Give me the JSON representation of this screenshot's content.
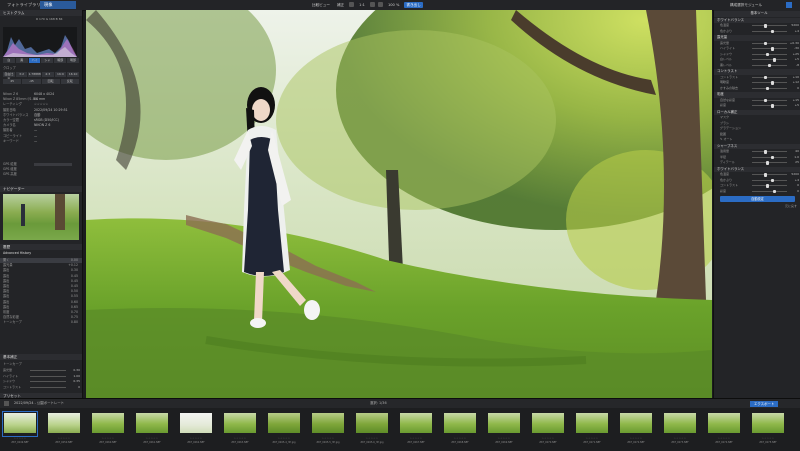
{
  "topbar": {
    "tabs": [
      {
        "label": "フォトライブラリ",
        "active": false
      },
      {
        "label": "現像",
        "active": true
      }
    ],
    "right_buttons": [
      "比較ビュー",
      "補正",
      "1:1",
      "100 %"
    ],
    "export_button": "書き出し",
    "right_label": "構成選択モジュール"
  },
  "left": {
    "histogram_title": "ヒストグラム",
    "histogram_readout": "R 170 G 168 B 84",
    "tool_row": [
      "白",
      "黒",
      "ハイ",
      "シャ",
      "暗部",
      "明部"
    ],
    "crop_title": "クロップ",
    "ratio_buttons": [
      "自由比率",
      "3:2",
      "1.78888",
      "4:3",
      "16:9",
      "16:10"
    ],
    "rotate_buttons": [
      "45",
      "-45",
      "回転",
      "反転"
    ],
    "meta": [
      {
        "k": "Nikon Z 6",
        "v": "6048 x 4024"
      },
      {
        "k": "Nikon Z 85mm f/1.8 S",
        "v": "84 mm"
      },
      {
        "k": "レーティング",
        "v": "☆☆☆☆☆"
      },
      {
        "k": "撮影日時",
        "v": "2022/09/24 10:29:51"
      },
      {
        "k": "ホワイトバランス",
        "v": "自動"
      },
      {
        "k": "カラー空間",
        "v": "sRGB (D50/ICC)"
      },
      {
        "k": "カメラ名",
        "v": "NIKON Z 6"
      },
      {
        "k": "撮影者",
        "v": "—"
      },
      {
        "k": "コピーライト",
        "v": "—"
      },
      {
        "k": "キーワード",
        "v": "—"
      }
    ],
    "gps_rows": [
      "GPS 緯度",
      "GPS 経度",
      "GPS 高度"
    ],
    "navigator_title": "ナビゲーター",
    "history_title": "履歴",
    "history_group": "Advanced History",
    "history_items": [
      {
        "label": "開く",
        "value": "0.00"
      },
      {
        "label": "露光量",
        "value": "+0.12"
      },
      {
        "label": "露出",
        "value": "0.30"
      },
      {
        "label": "露出",
        "value": "0.45"
      },
      {
        "label": "露出",
        "value": "0.45"
      },
      {
        "label": "露出",
        "value": "0.45"
      },
      {
        "label": "露出",
        "value": "0.50"
      },
      {
        "label": "露出",
        "value": "0.55"
      },
      {
        "label": "露出",
        "value": "0.60"
      },
      {
        "label": "露出",
        "value": "0.65"
      },
      {
        "label": "彩度",
        "value": "0.70"
      },
      {
        "label": "自然な彩度",
        "value": "0.75"
      },
      {
        "label": "トーンカーブ",
        "value": "0.80"
      }
    ],
    "tone_title": "基本補正",
    "tone_group": "トーンカーブ",
    "tone_rows": [
      {
        "label": "露光量",
        "value": "0.30"
      },
      {
        "label": "ハイライト",
        "value": "1.00"
      },
      {
        "label": "シャドウ",
        "value": "0.35"
      },
      {
        "label": "コントラスト",
        "value": "0"
      }
    ],
    "bottom_title": "プリセット"
  },
  "right": {
    "header": "基本ツール",
    "sections": [
      {
        "title": "ホワイトバランス",
        "rows": [
          {
            "label": "色温度",
            "value": "5200"
          },
          {
            "label": "色かぶり",
            "value": "+4"
          }
        ]
      },
      {
        "title": "露光量",
        "rows": [
          {
            "label": "露光量",
            "value": "+0.30"
          },
          {
            "label": "ハイライト",
            "value": "-30"
          },
          {
            "label": "シャドウ",
            "value": "+25"
          },
          {
            "label": "白レベル",
            "value": "+5"
          },
          {
            "label": "黒レベル",
            "value": "-8"
          }
        ]
      },
      {
        "title": "コントラスト",
        "rows": [
          {
            "label": "コントラスト",
            "value": "+10"
          },
          {
            "label": "明瞭度",
            "value": "+12"
          },
          {
            "label": "かすみの除去",
            "value": "0"
          }
        ]
      },
      {
        "title": "彩度",
        "rows": [
          {
            "label": "自然な彩度",
            "value": "+15"
          },
          {
            "label": "彩度",
            "value": "+5"
          }
        ]
      }
    ],
    "local_title": "ローカル補正",
    "local_rows": [
      "マスク",
      "ブラシ",
      "グラデーション",
      "範囲"
    ],
    "auto_label": "オート",
    "sharpen_title": "シャープネス",
    "sharpen_rows": [
      {
        "label": "適用量",
        "value": "40"
      },
      {
        "label": "半径",
        "value": "1.0"
      },
      {
        "label": "ディテール",
        "value": "25"
      }
    ],
    "wb2_title": "ホワイトバランス",
    "wb2_rows": [
      {
        "label": "色温度",
        "value": "5200"
      },
      {
        "label": "色かぶり",
        "value": "+4"
      },
      {
        "label": "コントラスト",
        "value": "0"
      },
      {
        "label": "彩度",
        "value": "0"
      }
    ],
    "apply_button": "自動設定",
    "reset_button": "元に戻す"
  },
  "filmstrip": {
    "path": "2022/09/24 - 公園ポートレート",
    "count": "選択: 1/36",
    "right_label": "エクスポート",
    "thumbs": [
      {
        "name": "Z6T_0249.NEF",
        "tone": "a"
      },
      {
        "name": "Z6T_0250.NEF",
        "tone": "a"
      },
      {
        "name": "Z6T_0260.NEF",
        "tone": "b"
      },
      {
        "name": "Z6T_0261.NEF",
        "tone": "b"
      },
      {
        "name": "Z6T_0262.NEF",
        "tone": "c"
      },
      {
        "name": "Z6T_0263.NEF",
        "tone": "b"
      },
      {
        "name": "Z6T_0265-4_3fr.jpg",
        "tone": "d"
      },
      {
        "name": "Z6T_0265-5_3fr.jpg",
        "tone": "d"
      },
      {
        "name": "Z6T_0265-6_3fr.jpg",
        "tone": "d"
      },
      {
        "name": "Z6T_0267.NEF",
        "tone": "b"
      },
      {
        "name": "Z6T_0268.NEF",
        "tone": "b"
      },
      {
        "name": "Z6T_0269.NEF",
        "tone": "b"
      },
      {
        "name": "Z6T_0270.NEF",
        "tone": "b"
      },
      {
        "name": "Z6T_0271.NEF",
        "tone": "b"
      },
      {
        "name": "Z6T_0272.NEF",
        "tone": "b"
      },
      {
        "name": "Z6T_0273.NEF",
        "tone": "b"
      },
      {
        "name": "Z6T_0274.NEF",
        "tone": "b"
      },
      {
        "name": "Z6T_0275.NEF",
        "tone": "b"
      }
    ],
    "stars": "☆☆☆☆☆"
  },
  "colors": {
    "accent": "#2b6cc4",
    "panel": "#232427",
    "bg": "#1b1c1e"
  }
}
